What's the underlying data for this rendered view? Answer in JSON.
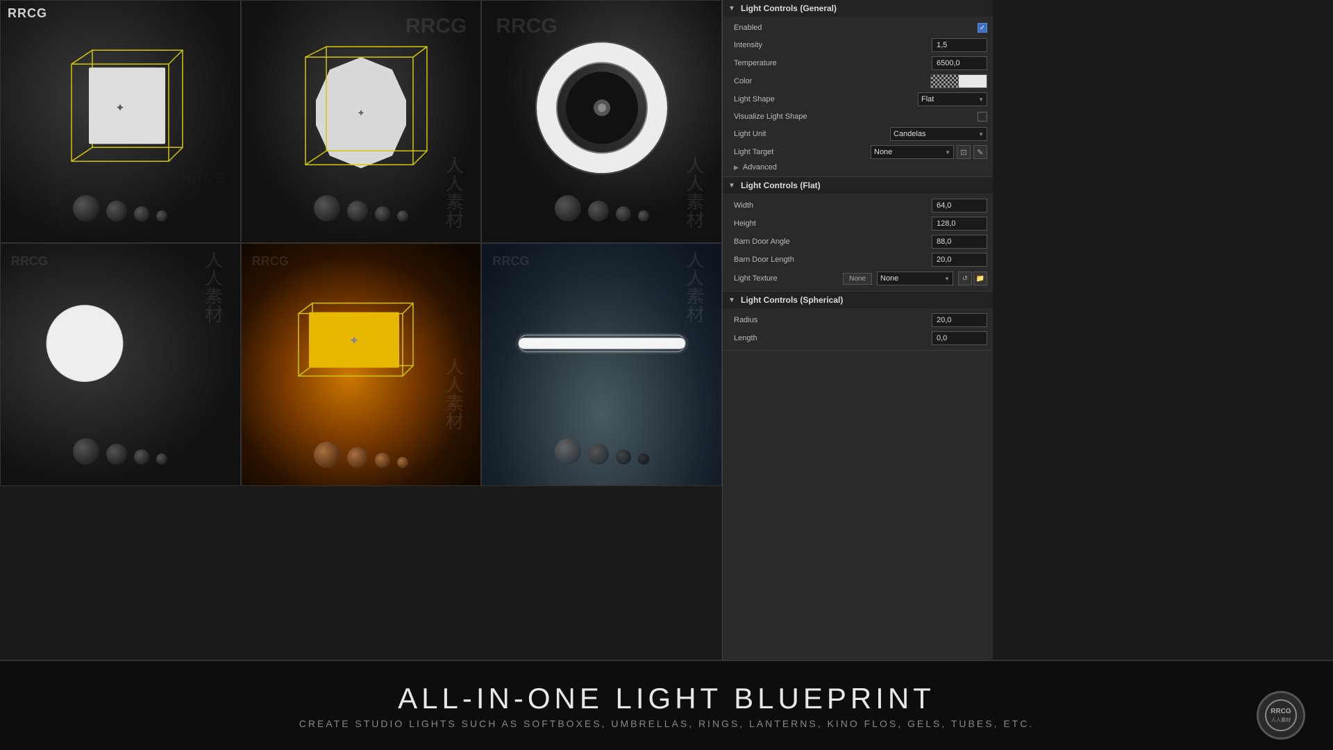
{
  "brand": {
    "name": "RRCG",
    "watermark": "RRCG",
    "chinese": "人人素材"
  },
  "banner": {
    "title": "ALL-IN-ONE LIGHT BLUEPRINT",
    "subtitle": "CREATE STUDIO LIGHTS SUCH AS SOFTBOXES, UMBRELLAS, RINGS, LANTERNS, KINO FLOS, GELS, TUBES, ETC.",
    "logo_text": "RRCG",
    "logo_sub": "人人素材"
  },
  "panel": {
    "sections": {
      "general": {
        "title": "Light Controls (General)",
        "props": {
          "enabled_label": "Enabled",
          "intensity_label": "Intensity",
          "intensity_value": "1,5",
          "temperature_label": "Temperature",
          "temperature_value": "6500,0",
          "color_label": "Color",
          "light_shape_label": "Light Shape",
          "light_shape_value": "Flat",
          "visualize_light_shape_label": "Visualize Light Shape",
          "light_unit_label": "Light Unit",
          "light_unit_value": "Candelas",
          "light_target_label": "Light Target",
          "light_target_value": "None",
          "advanced_label": "Advanced"
        }
      },
      "flat": {
        "title": "Light Controls (Flat)",
        "props": {
          "width_label": "Width",
          "width_value": "64,0",
          "height_label": "Height",
          "height_value": "128,0",
          "barn_door_angle_label": "Barn Door Angle",
          "barn_door_angle_value": "88,0",
          "barn_door_length_label": "Barn Door Length",
          "barn_door_length_value": "20,0",
          "light_texture_label": "Light Texture",
          "light_texture_none": "None",
          "light_texture_select": "None"
        }
      },
      "spherical": {
        "title": "Light Controls (Spherical)",
        "props": {
          "radius_label": "Radius",
          "radius_value": "20,0",
          "length_label": "Length",
          "length_value": "0,0"
        }
      }
    }
  }
}
